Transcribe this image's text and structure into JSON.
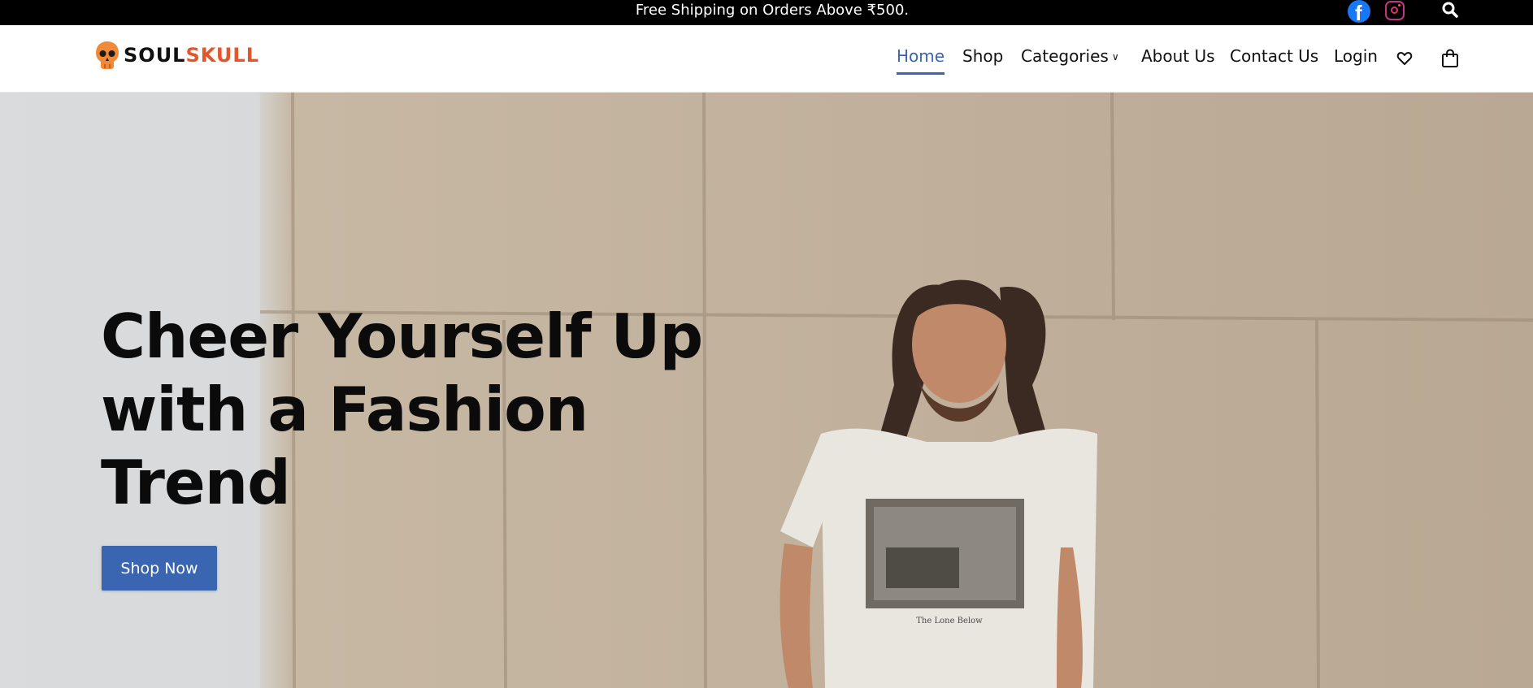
{
  "topbar": {
    "announcement": "Free Shipping on Orders Above ₹500.",
    "background": "#000000",
    "icons": [
      "facebook-icon",
      "instagram-icon",
      "search-icon"
    ]
  },
  "brand": {
    "logo_part1": "SOUL",
    "logo_part2": "SKULL",
    "accent": "#e3562c"
  },
  "nav": {
    "items": [
      {
        "label": "Home",
        "active": true
      },
      {
        "label": "Shop"
      },
      {
        "label": "Categories",
        "has_dropdown": true
      },
      {
        "label": "About Us"
      },
      {
        "label": "Contact Us"
      },
      {
        "label": "Login"
      }
    ],
    "icons": [
      "heart-icon",
      "cart-icon"
    ],
    "active_color": "#3a65b0"
  },
  "hero": {
    "title_line1": "Cheer Yourself Up",
    "title_line2": "with a Fashion",
    "title_line3": "Trend",
    "cta": "Shop Now",
    "shirt_print": "The Lone Below",
    "cta_color": "#3a65b0"
  }
}
